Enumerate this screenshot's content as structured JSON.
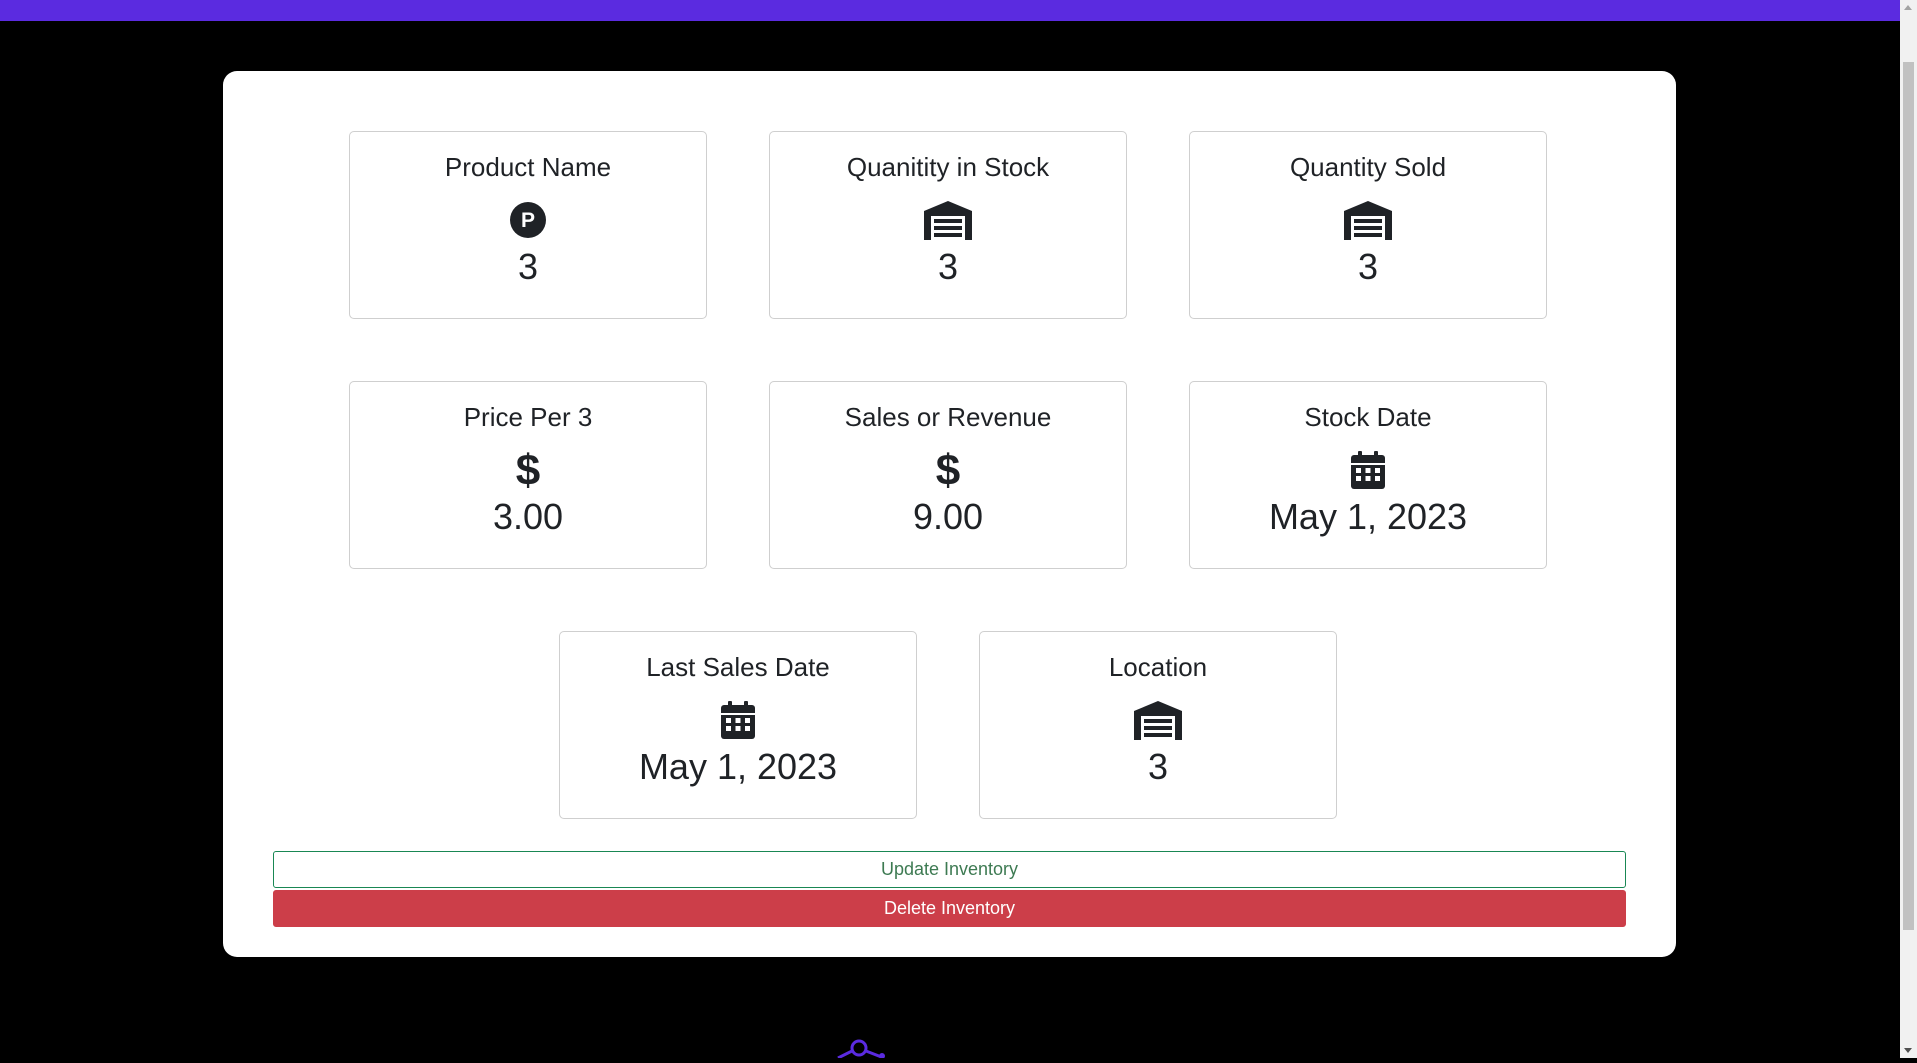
{
  "cards": [
    {
      "label": "Product Name",
      "icon": "parking-circle-icon",
      "value": "3"
    },
    {
      "label": "Quanitity in Stock",
      "icon": "warehouse-icon",
      "value": "3"
    },
    {
      "label": "Quantity Sold",
      "icon": "warehouse-icon",
      "value": "3"
    },
    {
      "label": "Price Per 3",
      "icon": "dollar-icon",
      "value": "3.00"
    },
    {
      "label": "Sales or Revenue",
      "icon": "dollar-icon",
      "value": "9.00"
    },
    {
      "label": "Stock Date",
      "icon": "calendar-icon",
      "value": "May 1, 2023"
    },
    {
      "label": "Last Sales Date",
      "icon": "calendar-icon",
      "value": "May 1, 2023"
    },
    {
      "label": "Location",
      "icon": "warehouse-icon",
      "value": "3"
    }
  ],
  "actions": {
    "update_label": "Update Inventory",
    "delete_label": "Delete Inventory"
  },
  "colors": {
    "navbar": "#5b2be0",
    "update_border": "#198754",
    "delete_bg": "#cc3e49"
  }
}
